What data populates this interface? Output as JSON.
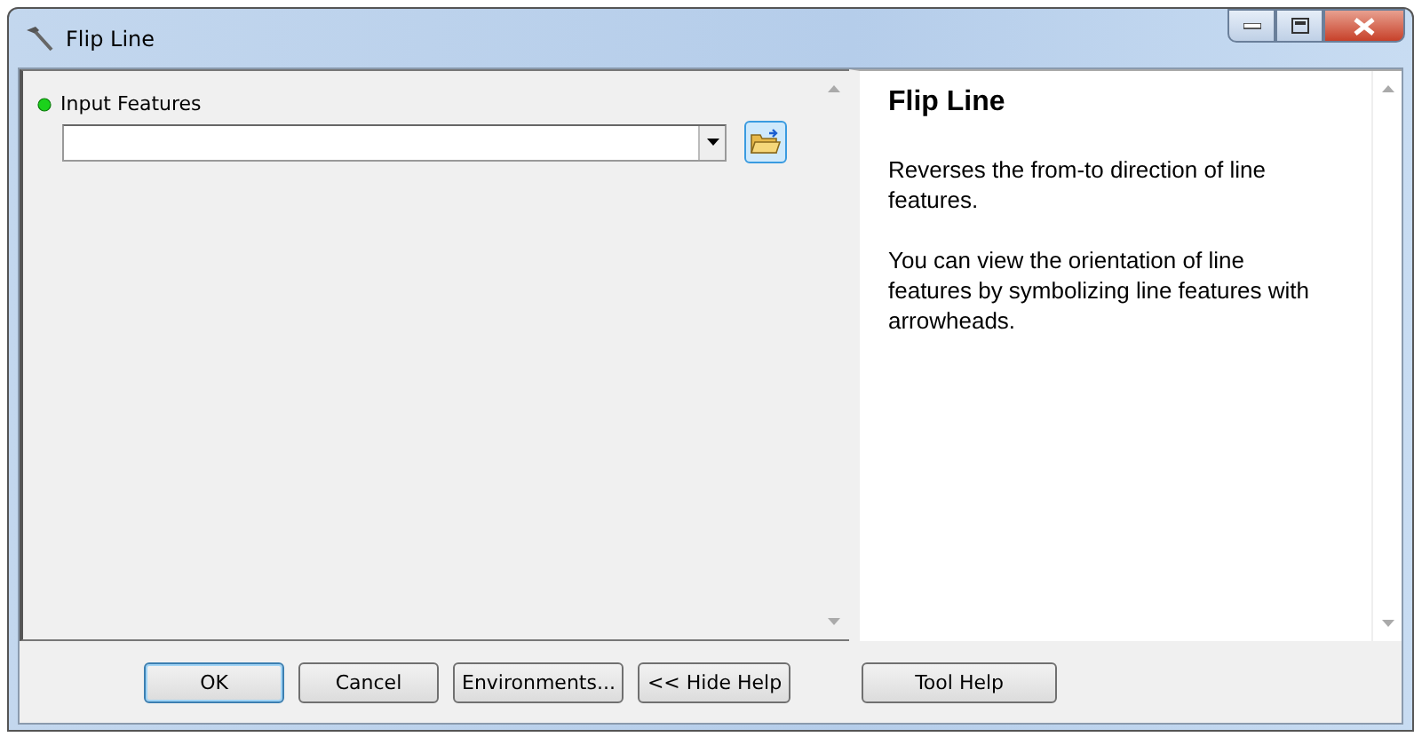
{
  "window": {
    "title": "Flip Line"
  },
  "parameters": [
    {
      "label": "Input Features",
      "required": true
    }
  ],
  "help": {
    "title": "Flip Line",
    "paragraphs": [
      "Reverses the from-to direction of line features.",
      "You can view the orientation of line features by symbolizing line features with arrowheads."
    ]
  },
  "buttons": [
    {
      "label": "OK",
      "default": true
    },
    {
      "label": "Cancel",
      "default": false
    },
    {
      "label": "Environments...",
      "default": false
    },
    {
      "label": "<< Hide Help",
      "default": false
    },
    {
      "label": "Tool Help",
      "default": false
    }
  ]
}
